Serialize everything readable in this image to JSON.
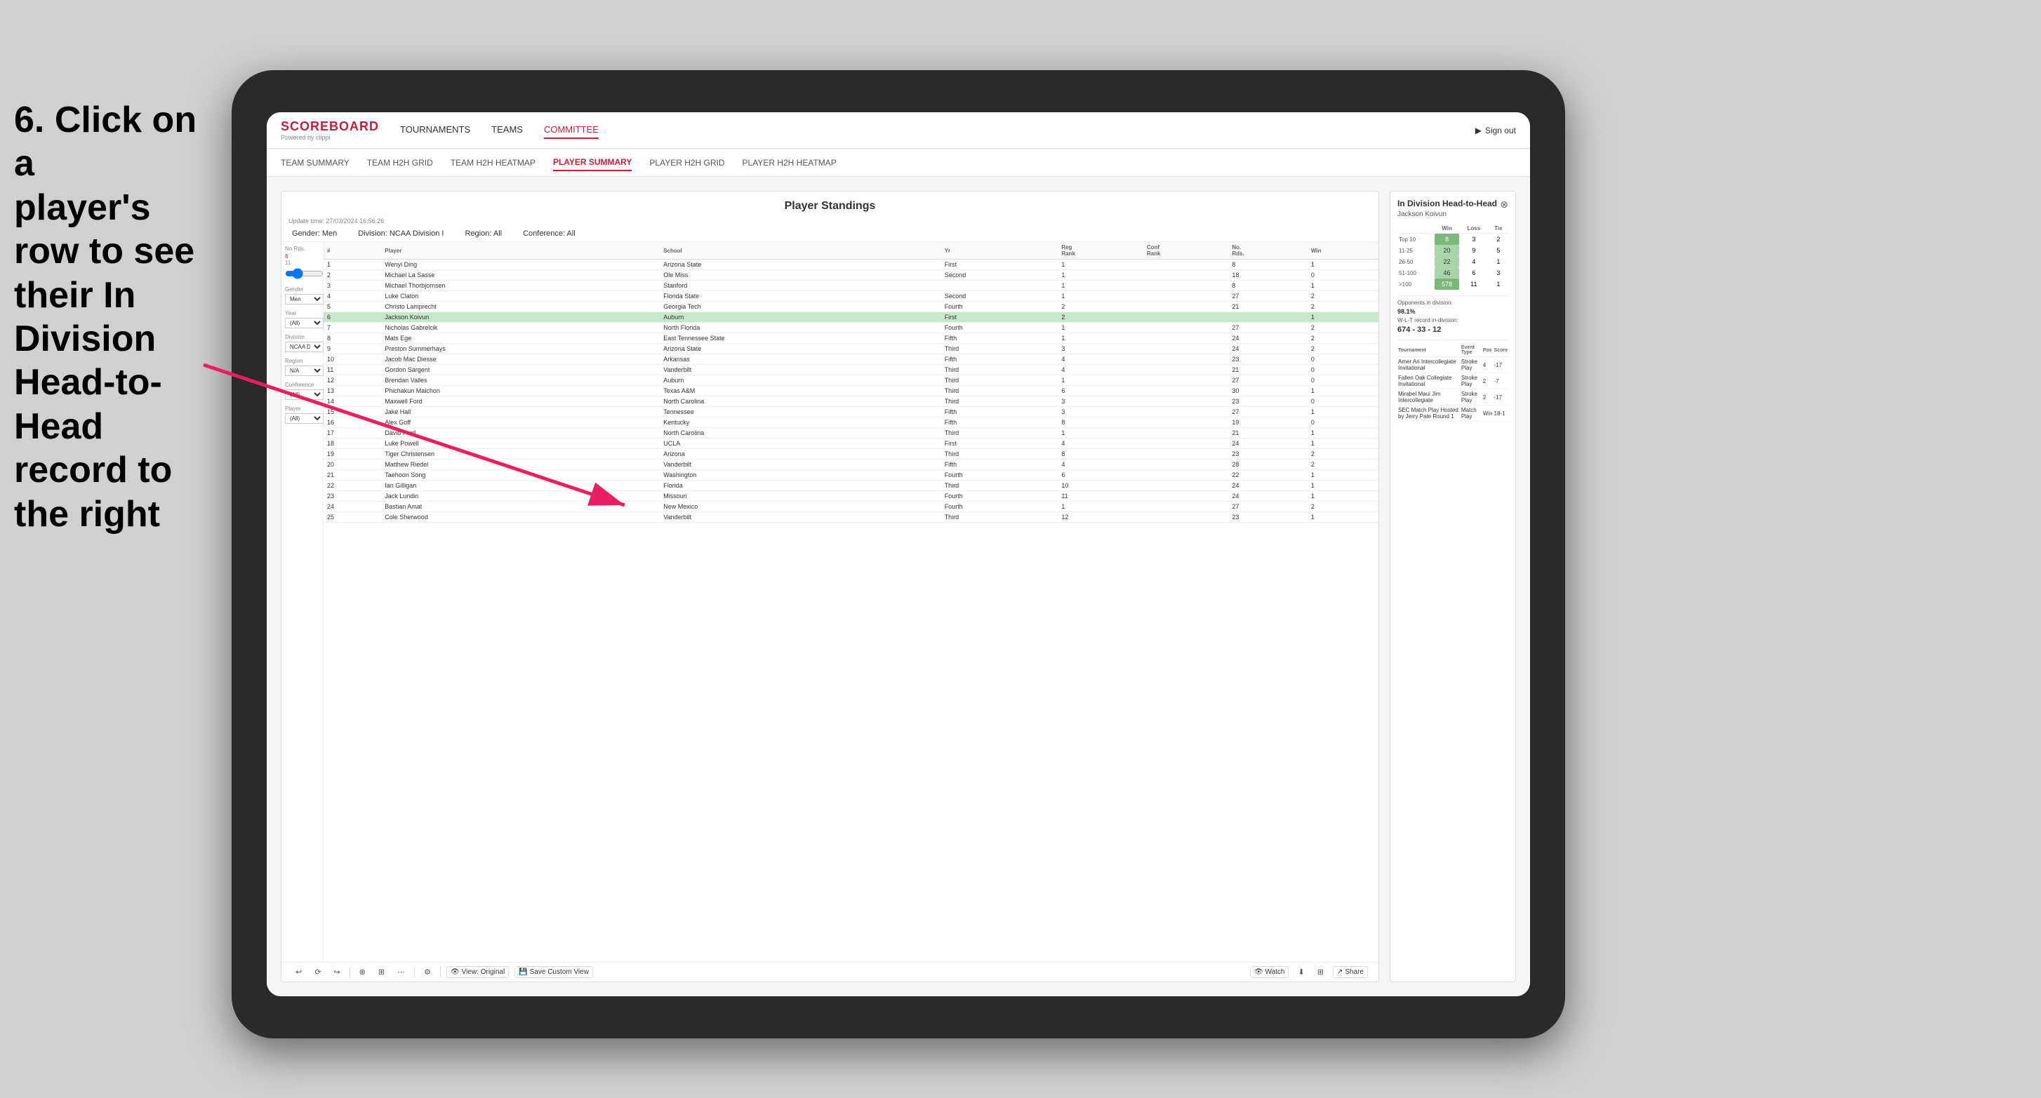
{
  "instruction": {
    "line1": "6. Click on a",
    "line2": "player's row to see",
    "line3": "their In Division",
    "line4": "Head-to-Head",
    "line5": "record to the right"
  },
  "nav": {
    "logo": "SCOREBOARD",
    "logo_sub": "Powered by clippi",
    "items": [
      "TOURNAMENTS",
      "TEAMS",
      "COMMITTEE"
    ],
    "sign_out": "Sign out"
  },
  "sub_nav": {
    "items": [
      "TEAM SUMMARY",
      "TEAM H2H GRID",
      "TEAM H2H HEATMAP",
      "PLAYER SUMMARY",
      "PLAYER H2H GRID",
      "PLAYER H2H HEATMAP"
    ]
  },
  "panel": {
    "title": "Player Standings",
    "update_time": "Update time:",
    "update_date": "27/03/2024 16:56:26",
    "filters": {
      "gender_label": "Gender:",
      "gender_value": "Men",
      "division_label": "Division:",
      "division_value": "NCAA Division I",
      "region_label": "Region:",
      "region_value": "All",
      "conference_label": "Conference:",
      "conference_value": "All"
    }
  },
  "sidebar_filters": {
    "no_rds_label": "No Rds.",
    "no_rds_value": "6",
    "no_rds_subtext": "11",
    "gender_label": "Gender",
    "gender_value": "Men",
    "year_label": "Year",
    "year_value": "(All)",
    "division_label": "Division",
    "division_value": "NCAA Division I",
    "region_label": "Region",
    "region_value": "N/A",
    "conference_label": "Conference",
    "conference_value": "(All)",
    "player_label": "Player",
    "player_value": "(All)"
  },
  "table": {
    "headers": [
      "#",
      "Player",
      "School",
      "Yr",
      "Reg Rank",
      "Conf Rank",
      "No. Rds.",
      "Win"
    ],
    "rows": [
      {
        "rank": "1",
        "num": "1",
        "player": "Wenyi Ding",
        "school": "Arizona State",
        "yr": "First",
        "reg_rank": "1",
        "conf_rank": "",
        "no_rds": "8",
        "win": "1"
      },
      {
        "rank": "2",
        "num": "2",
        "player": "Michael La Sasse",
        "school": "Ole Miss",
        "yr": "Second",
        "reg_rank": "1",
        "conf_rank": "",
        "no_rds": "18",
        "win": "0"
      },
      {
        "rank": "3",
        "num": "3",
        "player": "Michael Thorbjornsen",
        "school": "Stanford",
        "yr": "",
        "reg_rank": "1",
        "conf_rank": "",
        "no_rds": "8",
        "win": "1"
      },
      {
        "rank": "4",
        "num": "4",
        "player": "Luke Claton",
        "school": "Florida State",
        "yr": "Second",
        "reg_rank": "1",
        "conf_rank": "",
        "no_rds": "27",
        "win": "2"
      },
      {
        "rank": "5",
        "num": "5",
        "player": "Christo Lamprecht",
        "school": "Georgia Tech",
        "yr": "Fourth",
        "reg_rank": "2",
        "conf_rank": "",
        "no_rds": "21",
        "win": "2"
      },
      {
        "rank": "6",
        "num": "6",
        "player": "Jackson Koivun",
        "school": "Auburn",
        "yr": "First",
        "reg_rank": "2",
        "conf_rank": "",
        "no_rds": "",
        "win": "1",
        "highlighted": true
      },
      {
        "rank": "7",
        "num": "7",
        "player": "Nicholas Gabrelcik",
        "school": "North Florida",
        "yr": "Fourth",
        "reg_rank": "1",
        "conf_rank": "",
        "no_rds": "27",
        "win": "2"
      },
      {
        "rank": "8",
        "num": "8",
        "player": "Mats Ege",
        "school": "East Tennessee State",
        "yr": "Fifth",
        "reg_rank": "1",
        "conf_rank": "",
        "no_rds": "24",
        "win": "2"
      },
      {
        "rank": "9",
        "num": "9",
        "player": "Preston Summerhays",
        "school": "Arizona State",
        "yr": "Third",
        "reg_rank": "3",
        "conf_rank": "",
        "no_rds": "24",
        "win": "2"
      },
      {
        "rank": "10",
        "num": "10",
        "player": "Jacob Mac Diesse",
        "school": "Arkansas",
        "yr": "Fifth",
        "reg_rank": "4",
        "conf_rank": "",
        "no_rds": "23",
        "win": "0"
      },
      {
        "rank": "11",
        "num": "11",
        "player": "Gordon Sargent",
        "school": "Vanderbilt",
        "yr": "Third",
        "reg_rank": "4",
        "conf_rank": "",
        "no_rds": "21",
        "win": "0"
      },
      {
        "rank": "12",
        "num": "12",
        "player": "Brendan Valles",
        "school": "Auburn",
        "yr": "Third",
        "reg_rank": "1",
        "conf_rank": "",
        "no_rds": "27",
        "win": "0"
      },
      {
        "rank": "13",
        "num": "13",
        "player": "Phichakun Maichon",
        "school": "Texas A&M",
        "yr": "Third",
        "reg_rank": "6",
        "conf_rank": "",
        "no_rds": "30",
        "win": "1"
      },
      {
        "rank": "14",
        "num": "14",
        "player": "Maxwell Ford",
        "school": "North Carolina",
        "yr": "Third",
        "reg_rank": "3",
        "conf_rank": "",
        "no_rds": "23",
        "win": "0"
      },
      {
        "rank": "15",
        "num": "15",
        "player": "Jake Hall",
        "school": "Tennessee",
        "yr": "Fifth",
        "reg_rank": "3",
        "conf_rank": "",
        "no_rds": "27",
        "win": "1"
      },
      {
        "rank": "16",
        "num": "16",
        "player": "Alex Goff",
        "school": "Kentucky",
        "yr": "Fifth",
        "reg_rank": "8",
        "conf_rank": "",
        "no_rds": "19",
        "win": "0"
      },
      {
        "rank": "17",
        "num": "17",
        "player": "David Ford",
        "school": "North Carolina",
        "yr": "Third",
        "reg_rank": "1",
        "conf_rank": "",
        "no_rds": "21",
        "win": "1"
      },
      {
        "rank": "18",
        "num": "18",
        "player": "Luke Powell",
        "school": "UCLA",
        "yr": "First",
        "reg_rank": "4",
        "conf_rank": "",
        "no_rds": "24",
        "win": "1"
      },
      {
        "rank": "19",
        "num": "19",
        "player": "Tiger Christensen",
        "school": "Arizona",
        "yr": "Third",
        "reg_rank": "8",
        "conf_rank": "",
        "no_rds": "23",
        "win": "2"
      },
      {
        "rank": "20",
        "num": "20",
        "player": "Matthew Riedel",
        "school": "Vanderbilt",
        "yr": "Fifth",
        "reg_rank": "4",
        "conf_rank": "",
        "no_rds": "28",
        "win": "2"
      },
      {
        "rank": "21",
        "num": "21",
        "player": "Taehoon Song",
        "school": "Washington",
        "yr": "Fourth",
        "reg_rank": "6",
        "conf_rank": "",
        "no_rds": "22",
        "win": "1"
      },
      {
        "rank": "22",
        "num": "22",
        "player": "Ian Gilligan",
        "school": "Florida",
        "yr": "Third",
        "reg_rank": "10",
        "conf_rank": "",
        "no_rds": "24",
        "win": "1"
      },
      {
        "rank": "23",
        "num": "23",
        "player": "Jack Lundin",
        "school": "Missouri",
        "yr": "Fourth",
        "reg_rank": "11",
        "conf_rank": "",
        "no_rds": "24",
        "win": "1"
      },
      {
        "rank": "24",
        "num": "24",
        "player": "Bastian Amat",
        "school": "New Mexico",
        "yr": "Fourth",
        "reg_rank": "1",
        "conf_rank": "",
        "no_rds": "27",
        "win": "2"
      },
      {
        "rank": "25",
        "num": "25",
        "player": "Cole Sherwood",
        "school": "Vanderbilt",
        "yr": "Third",
        "reg_rank": "12",
        "conf_rank": "",
        "no_rds": "23",
        "win": "1"
      }
    ]
  },
  "h2h": {
    "title": "In Division Head-to-Head",
    "player": "Jackson Koivun",
    "table_headers": [
      "Win",
      "Loss",
      "Tie"
    ],
    "rows": [
      {
        "label": "Top 10",
        "win": "8",
        "loss": "3",
        "tie": "2",
        "win_class": "cell-green"
      },
      {
        "label": "11-25",
        "win": "20",
        "loss": "9",
        "tie": "5",
        "win_class": "cell-light-green"
      },
      {
        "label": "26-50",
        "win": "22",
        "loss": "4",
        "tie": "1",
        "win_class": "cell-light-green"
      },
      {
        "label": "51-100",
        "win": "46",
        "loss": "6",
        "tie": "3",
        "win_class": "cell-light-green"
      },
      {
        "label": ">100",
        "win": "578",
        "loss": "11",
        "tie": "1",
        "win_class": "cell-green"
      }
    ],
    "opponents_label": "Opponents in division:",
    "wlt_label": "W-L-T record in-division:",
    "opponents_value": "98.1%",
    "wlt_value": "674 - 33 - 12",
    "tournament_headers": [
      "Tournament",
      "Event Type",
      "Pos",
      "Score"
    ],
    "tournaments": [
      {
        "name": "Amer Ari Intercollegiate Invitational",
        "type": "Stroke Play",
        "pos": "4",
        "score": "-17"
      },
      {
        "name": "Fallen Oak Collegiate Invitational",
        "type": "Stroke Play",
        "pos": "2",
        "score": "-7"
      },
      {
        "name": "Mirabel Maui Jim Intercollegiate",
        "type": "Stroke Play",
        "pos": "2",
        "score": "-17"
      },
      {
        "name": "SEC Match Play Hosted by Jerry Pate Round 1",
        "type": "Match Play",
        "pos": "Win",
        "score": "18-1"
      }
    ]
  },
  "toolbar": {
    "view_original": "View: Original",
    "save_custom": "Save Custom View",
    "watch": "Watch",
    "share": "Share"
  }
}
